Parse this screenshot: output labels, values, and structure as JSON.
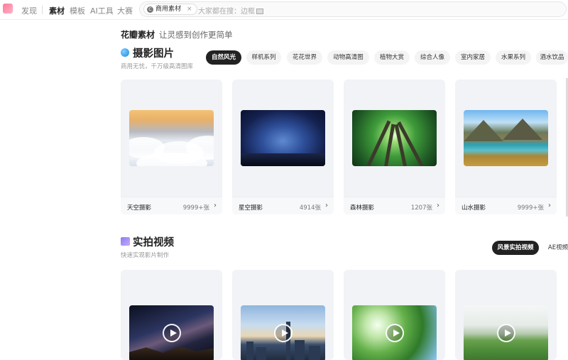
{
  "nav": {
    "items": [
      {
        "label": "发现",
        "active": false
      },
      {
        "label": "素材",
        "active": true
      },
      {
        "label": "模板",
        "active": false
      },
      {
        "label": "AI工具",
        "active": false
      },
      {
        "label": "大赛",
        "active": false
      }
    ]
  },
  "search": {
    "chip_icon": "C",
    "chip_label": "商用素材",
    "chip_close": "×",
    "prompt": "大家都在搜：边框"
  },
  "header": {
    "brand": "花瓣素材",
    "slogan": "让灵感到创作更简单"
  },
  "photo_section": {
    "icon": "blue-globe-icon",
    "title": "摄影图片",
    "subtitle": "商用无忧，千万级高清图库",
    "tabs": [
      "自然风光",
      "样机系列",
      "花花世界",
      "动物高清图",
      "植物大赏",
      "综合人像",
      "室内家居",
      "水果系列",
      "酒水饮品"
    ],
    "active_tab": 0,
    "cards": [
      {
        "name": "天空摄影",
        "count": "9999+张",
        "arrow": "›"
      },
      {
        "name": "星空摄影",
        "count": "4914张",
        "arrow": "›"
      },
      {
        "name": "森林摄影",
        "count": "1207张",
        "arrow": "›"
      },
      {
        "name": "山水摄影",
        "count": "9999+张",
        "arrow": "›"
      }
    ]
  },
  "video_section": {
    "icon": "purple-video-icon",
    "title": "实拍视频",
    "subtitle": "快速实现影片制作",
    "tabs": [
      "风景实拍视频",
      "AE视频"
    ],
    "active_tab": 0,
    "cards": [
      {
        "scene": "milky-way"
      },
      {
        "scene": "city-skyline"
      },
      {
        "scene": "green-leaves"
      },
      {
        "scene": "green-hills"
      }
    ]
  },
  "colors": {
    "accent_dark": "#222222",
    "card_bg": "#f1f3f6",
    "logo": "#ff7a9a"
  }
}
